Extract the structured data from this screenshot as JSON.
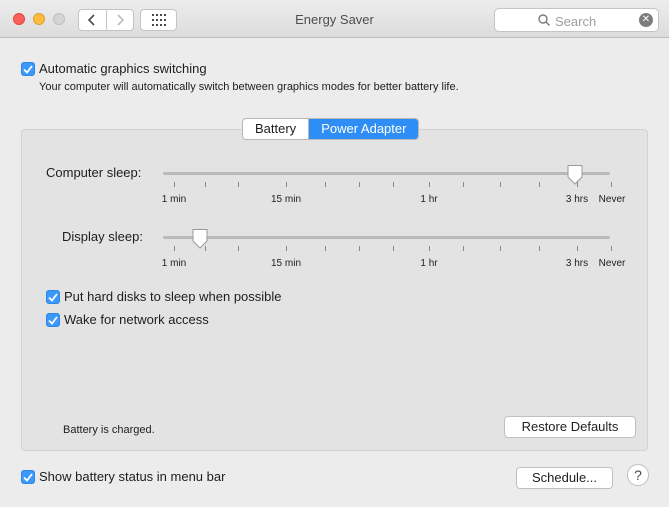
{
  "window": {
    "title": "Energy Saver"
  },
  "search": {
    "placeholder": "Search"
  },
  "auto_switching": {
    "label": "Automatic graphics switching",
    "checked": true,
    "description": "Your computer will automatically switch between graphics modes for better battery life."
  },
  "tabs": [
    {
      "label": "Battery",
      "selected": false
    },
    {
      "label": "Power Adapter",
      "selected": true
    }
  ],
  "computer_sleep": {
    "label": "Computer sleep:",
    "scale": [
      "1 min",
      "15 min",
      "1 hr",
      "3 hrs",
      "Never"
    ],
    "value": "3 hrs"
  },
  "display_sleep": {
    "label": "Display sleep:",
    "scale": [
      "1 min",
      "15 min",
      "1 hr",
      "3 hrs",
      "Never"
    ],
    "value": "1 min"
  },
  "options": [
    {
      "label": "Put hard disks to sleep when possible",
      "checked": true
    },
    {
      "label": "Wake for network access",
      "checked": true
    }
  ],
  "status": "Battery is charged.",
  "restore_button": "Restore Defaults",
  "show_battery": {
    "label": "Show battery status in menu bar",
    "checked": true
  },
  "schedule_button": "Schedule...",
  "help_label": "?",
  "colors": {
    "accent": "#3b99fc",
    "close": "#fc605c",
    "minimize": "#fdbc40"
  }
}
